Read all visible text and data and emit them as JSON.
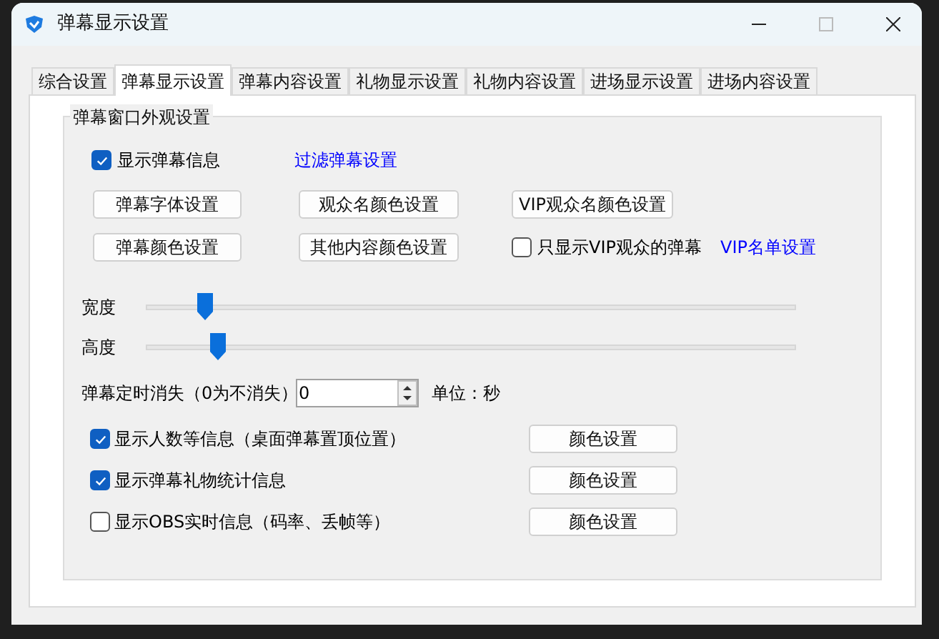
{
  "window": {
    "title": "弹幕显示设置"
  },
  "tabs": [
    {
      "label": "综合设置",
      "selected": false
    },
    {
      "label": "弹幕显示设置",
      "selected": true
    },
    {
      "label": "弹幕内容设置",
      "selected": false
    },
    {
      "label": "礼物显示设置",
      "selected": false
    },
    {
      "label": "礼物内容设置",
      "selected": false
    },
    {
      "label": "进场显示设置",
      "selected": false
    },
    {
      "label": "进场内容设置",
      "selected": false
    }
  ],
  "group": {
    "title": "弹幕窗口外观设置",
    "show_danmaku": {
      "label": "显示弹幕信息",
      "checked": true
    },
    "filter_link": "过滤弹幕设置",
    "buttons_row1": [
      "弹幕字体设置",
      "观众名颜色设置",
      "VIP观众名颜色设置"
    ],
    "buttons_row2": [
      "弹幕颜色设置",
      "其他内容颜色设置"
    ],
    "vip_only": {
      "label": "只显示VIP观众的弹幕",
      "checked": false
    },
    "vip_link": "VIP名单设置",
    "sliders": [
      {
        "label": "宽度",
        "level": 0.09
      },
      {
        "label": "高度",
        "level": 0.11
      }
    ],
    "timeout": {
      "label": "弹幕定时消失（0为不消失）",
      "value": "0",
      "unit": "单位：秒"
    },
    "info_rows": [
      {
        "label": "显示人数等信息（桌面弹幕置顶位置）",
        "checked": true,
        "button": "颜色设置"
      },
      {
        "label": "显示弹幕礼物统计信息",
        "checked": true,
        "button": "颜色设置"
      },
      {
        "label": "显示OBS实时信息（码率、丢帧等）",
        "checked": false,
        "button": "颜色设置"
      }
    ]
  }
}
